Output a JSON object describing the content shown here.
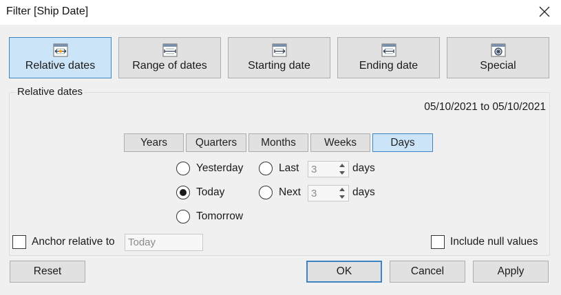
{
  "window": {
    "title": "Filter [Ship Date]",
    "close_icon": "close-icon"
  },
  "filter_types": [
    {
      "label": "Relative dates",
      "icon": "relative-dates-icon",
      "selected": true
    },
    {
      "label": "Range of dates",
      "icon": "range-of-dates-icon",
      "selected": false
    },
    {
      "label": "Starting date",
      "icon": "starting-date-icon",
      "selected": false
    },
    {
      "label": "Ending date",
      "icon": "ending-date-icon",
      "selected": false
    },
    {
      "label": "Special",
      "icon": "special-icon",
      "selected": false
    }
  ],
  "relative": {
    "group_label": "Relative dates",
    "range_text": "05/10/2021 to 05/10/2021",
    "periods": [
      "Years",
      "Quarters",
      "Months",
      "Weeks",
      "Days"
    ],
    "selected_period": "Days",
    "options": {
      "yesterday": "Yesterday",
      "today": "Today",
      "tomorrow": "Tomorrow",
      "last": "Last",
      "next": "Next"
    },
    "selected_option": "Today",
    "last_value": "3",
    "next_value": "3",
    "unit": "days"
  },
  "anchor": {
    "label": "Anchor relative to",
    "placeholder": "Today",
    "checked": false
  },
  "include_null": {
    "label": "Include null values",
    "checked": false
  },
  "footer": {
    "reset": "Reset",
    "ok": "OK",
    "cancel": "Cancel",
    "apply": "Apply"
  },
  "colors": {
    "selected_bg": "#cce4f7",
    "selected_border": "#3c83c4",
    "button_bg": "#e1e1e1",
    "dialog_bg": "#f0f0f0"
  }
}
